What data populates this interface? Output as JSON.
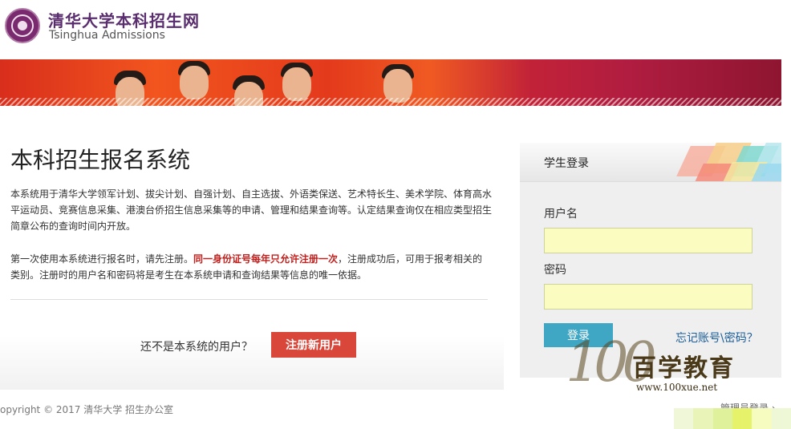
{
  "header": {
    "logo_cn": "清华大学本科招生网",
    "logo_en": "Tsinghua Admissions"
  },
  "main": {
    "title": "本科招生报名系统",
    "intro": "本系统用于清华大学领军计划、拔尖计划、自强计划、自主选拔、外语类保送、艺术特长生、美术学院、体育高水平运动员、竞赛信息采集、港澳台侨招生信息采集等的申请、管理和结果查询等。认定结果查询仅在相应类型招生简章公布的查询时间内开放。",
    "notice_before": "第一次使用本系统进行报名时，请先注册。",
    "notice_warn": "同一身份证号每年只允许注册一次",
    "notice_after": "，注册成功后，可用于报考相关的类别。注册时的用户名和密码将是考生在本系统申请和查询结果等信息的唯一依据。",
    "register_prompt": "还不是本系统的用户？",
    "register_button": "注册新用户"
  },
  "login": {
    "title": "学生登录",
    "username_label": "用户名",
    "password_label": "密码",
    "username_value": "",
    "password_value": "",
    "login_button": "登录",
    "forgot_link": "忘记账号\\密码？"
  },
  "watermark": {
    "mark": "100",
    "text": "百学教育",
    "url": "www.100xue.net"
  },
  "footer": {
    "copyright": "opyright © 2017 清华大学  招生办公室",
    "admin_link": "管理员登录 ›"
  },
  "colors": {
    "brand_purple": "#5a2d6e",
    "register_red": "#d9473a",
    "warning_red": "#c0201d",
    "login_blue": "#3fa6c4",
    "link_blue": "#1a5d9b",
    "field_yellow": "#fbfcc0"
  }
}
